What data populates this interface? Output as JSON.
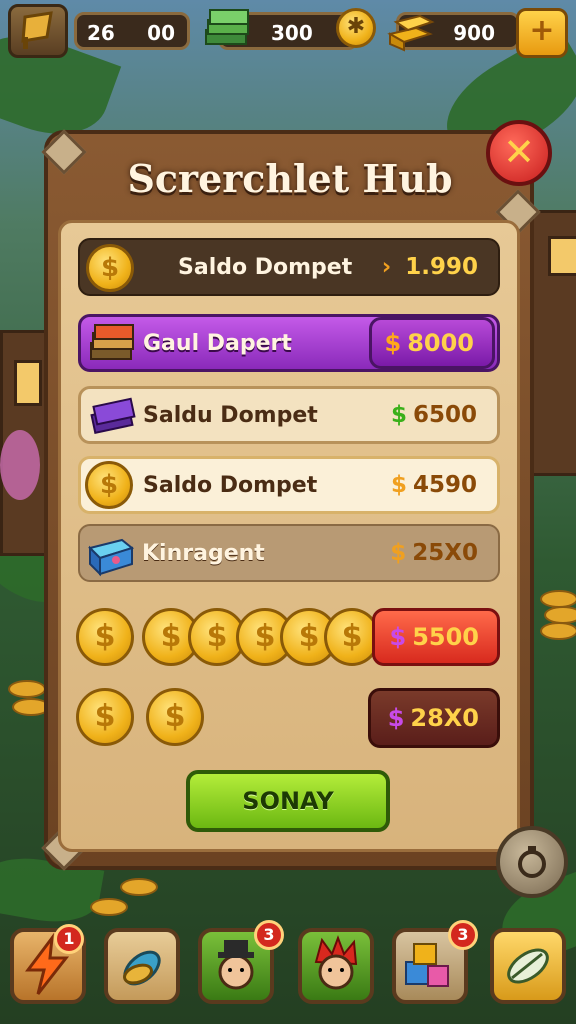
{
  "top_bar": {
    "left_stat": {
      "value_a": "26",
      "value_b": "00",
      "icon": "flag-icon"
    },
    "cash": {
      "value": "300",
      "icon": "cash-stack-icon",
      "add_icon": "coin-plus-icon"
    },
    "gold": {
      "value": "900",
      "icon": "gold-bars-icon",
      "add_icon": "plus-icon"
    }
  },
  "panel": {
    "title": "Screrchlet Hub",
    "close_icon": "close-icon",
    "rows": [
      {
        "label": "Saldo Dompet",
        "value": "1.990",
        "prefix": "›",
        "icon": "coin-icon",
        "style": "dark"
      },
      {
        "label": "Gaul Dapert",
        "value": "8000",
        "prefix": "$",
        "icon": "cash-bundle-icon",
        "style": "purple"
      },
      {
        "label": "Saldu Dompet",
        "value": "6500",
        "prefix": "$",
        "icon": "purple-cash-icon",
        "style": "light"
      },
      {
        "label": "Saldo Dompet",
        "value": "4590",
        "prefix": "$",
        "icon": "coin-icon",
        "style": "cream"
      },
      {
        "label": "Kinragent",
        "value": "25X0",
        "prefix": "$",
        "icon": "blue-gem-box-icon",
        "style": "muted"
      }
    ],
    "coin_rows": [
      {
        "coins": 7,
        "value": "5500",
        "prefix": "$",
        "style": "red"
      },
      {
        "coins": 2,
        "value": "28X0",
        "prefix": "$",
        "style": "maroon"
      }
    ],
    "action_button": "SONAY"
  },
  "side_button": {
    "icon": "ring-icon"
  },
  "dock": [
    {
      "icon": "lightning-icon",
      "badge": "1",
      "color": "#e0a24a"
    },
    {
      "icon": "leaf-icon",
      "badge": "",
      "color": "#d8b47a"
    },
    {
      "icon": "character-hat-icon",
      "badge": "3",
      "color": "#5a9a2a"
    },
    {
      "icon": "character-redhair-icon",
      "badge": "",
      "color": "#5a9a2a"
    },
    {
      "icon": "blocks-icon",
      "badge": "3",
      "color": "#b8a27a"
    },
    {
      "icon": "leaf-icon",
      "badge": "",
      "color": "#f0c24a"
    }
  ]
}
